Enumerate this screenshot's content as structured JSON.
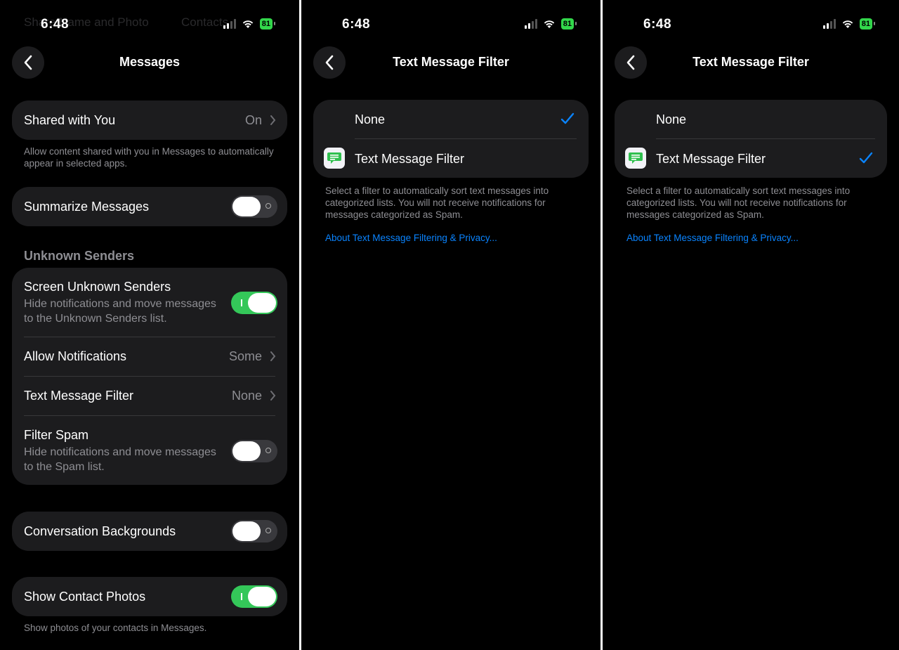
{
  "status": {
    "time": "6:48",
    "battery": "81"
  },
  "panel1": {
    "ghost_title": "Share Name and Photo",
    "ghost_title_right": "Contacts",
    "title": "Messages",
    "shared_with_you": {
      "label": "Shared with You",
      "value": "On"
    },
    "shared_with_you_footer": "Allow content shared with you in Messages to automatically appear in selected apps.",
    "summarize": {
      "label": "Summarize Messages",
      "on": false
    },
    "unknown_senders_header": "Unknown Senders",
    "screen_unknown": {
      "label": "Screen Unknown Senders",
      "sub": "Hide notifications and move messages to the Unknown Senders list.",
      "on": true
    },
    "allow_notifications": {
      "label": "Allow Notifications",
      "value": "Some"
    },
    "text_message_filter": {
      "label": "Text Message Filter",
      "value": "None"
    },
    "filter_spam": {
      "label": "Filter Spam",
      "sub": "Hide notifications and move messages to the Spam list.",
      "on": false
    },
    "conversation_backgrounds": {
      "label": "Conversation Backgrounds",
      "on": false
    },
    "show_contact_photos": {
      "label": "Show Contact Photos",
      "on": true
    },
    "show_contact_photos_footer": "Show photos of your contacts in Messages."
  },
  "panel2": {
    "title": "Text Message Filter",
    "option_none": "None",
    "option_filter": "Text Message Filter",
    "selected": "None",
    "footer": "Select a filter to automatically sort text messages into categorized lists. You will not receive notifications for messages categorized as Spam.",
    "link": "About Text Message Filtering & Privacy..."
  },
  "panel3": {
    "title": "Text Message Filter",
    "option_none": "None",
    "option_filter": "Text Message Filter",
    "selected": "Text Message Filter",
    "footer": "Select a filter to automatically sort text messages into categorized lists. You will not receive notifications for messages categorized as Spam.",
    "link": "About Text Message Filtering & Privacy..."
  },
  "colors": {
    "accent": "#0a84ff",
    "toggle_on": "#34c759",
    "card": "#1c1c1e"
  }
}
